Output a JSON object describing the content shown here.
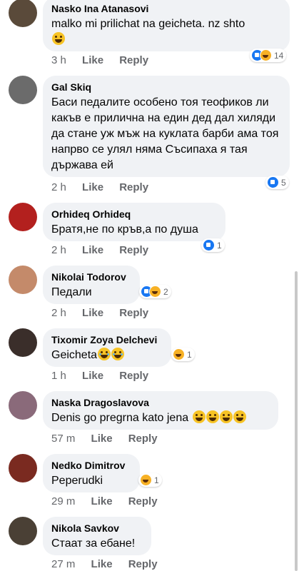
{
  "comments": [
    {
      "name": "Nasko Ina Atanasovi",
      "text": "malko mi prilichat na geicheta. nz shto",
      "emoji": "😄",
      "time": "3 h",
      "like": "Like",
      "reply": "Reply",
      "react_count": "14",
      "avatar_color": "#5a4a3a"
    },
    {
      "name": "Gal Skiq",
      "text": "Баси педалите особено тоя теофиков ли какъв е  прилична на един дед дал хиляди да стане уж мъж на куклата барби ама тоя напрво се улял няма Съсипаха я тая държава ей",
      "time": "2 h",
      "like": "Like",
      "reply": "Reply",
      "react_count": "5",
      "avatar_color": "#6b6b6b"
    },
    {
      "name": "Orhideq Orhideq",
      "text": "Братя,не по кръв,а по душа",
      "time": "2 h",
      "like": "Like",
      "reply": "Reply",
      "react_count": "1",
      "avatar_color": "#b3201e"
    },
    {
      "name": "Nikolai Todorov",
      "text": "Педали",
      "time": "2 h",
      "like": "Like",
      "reply": "Reply",
      "react_count": "2",
      "avatar_color": "#c48a6a"
    },
    {
      "name": "Tixomir Zoya Delchevi",
      "text": "Geicheta",
      "emoji": "😂😂",
      "time": "1 h",
      "like": "Like",
      "reply": "Reply",
      "react_count": "1",
      "avatar_color": "#3a2e2a"
    },
    {
      "name": "Naska Dragoslavova",
      "text": "Denis go pregrna kato jena",
      "emoji": "😀😀😀😀",
      "time": "57 m",
      "like": "Like",
      "reply": "Reply",
      "avatar_color": "#8a6a7a"
    },
    {
      "name": "Nedko Dimitrov",
      "text": "Peperudki",
      "time": "29 m",
      "like": "Like",
      "reply": "Reply",
      "react_count": "1",
      "avatar_color": "#7a2a20"
    },
    {
      "name": "Nikola Savkov",
      "text": "Стаат за ебане!",
      "time": "27 m",
      "like": "Like",
      "reply": "Reply",
      "avatar_color": "#4a4035"
    }
  ]
}
